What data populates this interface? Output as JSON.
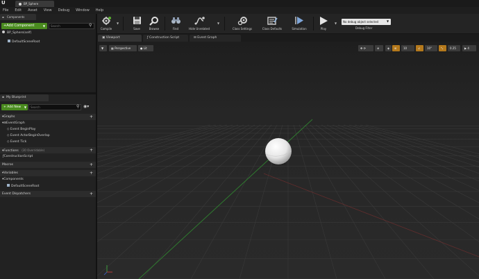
{
  "app": {
    "logo": "U",
    "document_tab": "BP_Sphere"
  },
  "menu": [
    "File",
    "Edit",
    "Asset",
    "View",
    "Debug",
    "Window",
    "Help"
  ],
  "toolbar": {
    "compile": "Compile",
    "save": "Save",
    "browse": "Browse",
    "find": "Find",
    "hide_unrelated": "Hide Unrelated",
    "class_settings": "Class Settings",
    "class_defaults": "Class Defaults",
    "simulation": "Simulation",
    "play": "Play",
    "debug_object": "No debug object selected",
    "debug_filter": "Debug Filter"
  },
  "components_panel": {
    "tab_label": "Components",
    "add_button": "+Add Component",
    "search_placeholder": "Search",
    "root": "BP_Sphere(self)",
    "child": "DefaultSceneRoot"
  },
  "my_blueprint": {
    "tab_label": "My Blueprint",
    "add_new": "+ Add New",
    "search_placeholder": "Search",
    "graphs_header": "Graphs",
    "event_graph": "EventGraph",
    "events": [
      "Event BeginPlay",
      "Event ActorBeginOverlap",
      "Event Tick"
    ],
    "functions_header": "Functions",
    "functions_count": "(30 Overridable)",
    "construction_script": "ConstructionScript",
    "macros_header": "Macros",
    "variables_header": "Variables",
    "components_sub": "Components",
    "default_scene_root": "DefaultSceneRoot",
    "dispatchers_header": "Event Dispatchers"
  },
  "editor_tabs": [
    "Viewport",
    "Construction Script",
    "Event Graph"
  ],
  "viewport": {
    "perspective": "Perspective",
    "lit": "Lit",
    "grid_snap": "10",
    "rotation_snap": "10°",
    "scale_snap": "0.25",
    "camera_speed": "4"
  },
  "colors": {
    "accent_green": "#4a8b1f",
    "background": "#151515"
  }
}
